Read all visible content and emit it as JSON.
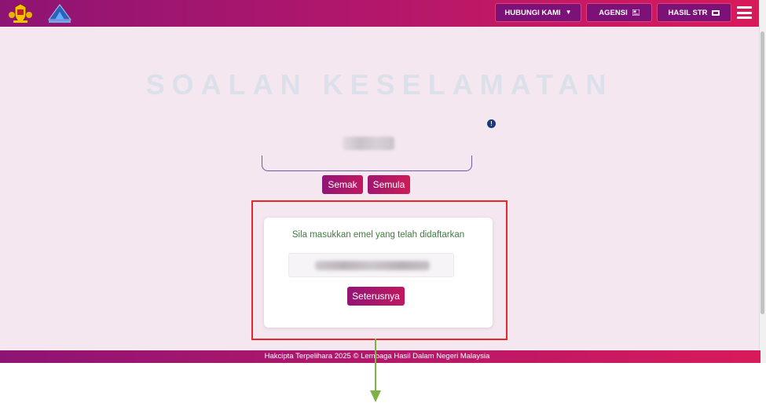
{
  "header": {
    "nav": [
      {
        "label": "HUBUNGI KAMI",
        "icon": "caret-down-icon"
      },
      {
        "label": "AGENSI",
        "icon": "flag-icon"
      },
      {
        "label": "HASIL STR",
        "icon": "ticket-icon"
      }
    ],
    "menu_icon": "hamburger-menu-icon",
    "logos": [
      "malaysia-crest-logo",
      "lhdn-logo"
    ]
  },
  "main": {
    "title": "SOALAN KESELAMATAN",
    "info_icon_glyph": "!",
    "buttons": {
      "semak": "Semak",
      "semula": "Semula"
    }
  },
  "email_card": {
    "message": "Sila masukkan emel yang telah didaftarkan",
    "next_button": "Seterusnya"
  },
  "footer": {
    "text": "Hakcipta Terpelihara 2025 © Lembaga Hasil Dalam Negeri Malaysia"
  },
  "colors": {
    "brand_gradient_start": "#8e1473",
    "brand_gradient_end": "#d81a5a",
    "page_background": "#f4e7f0",
    "message_text": "#3f7c3f",
    "annotation_red": "#e8262b",
    "annotation_arrow": "#7cb342"
  }
}
